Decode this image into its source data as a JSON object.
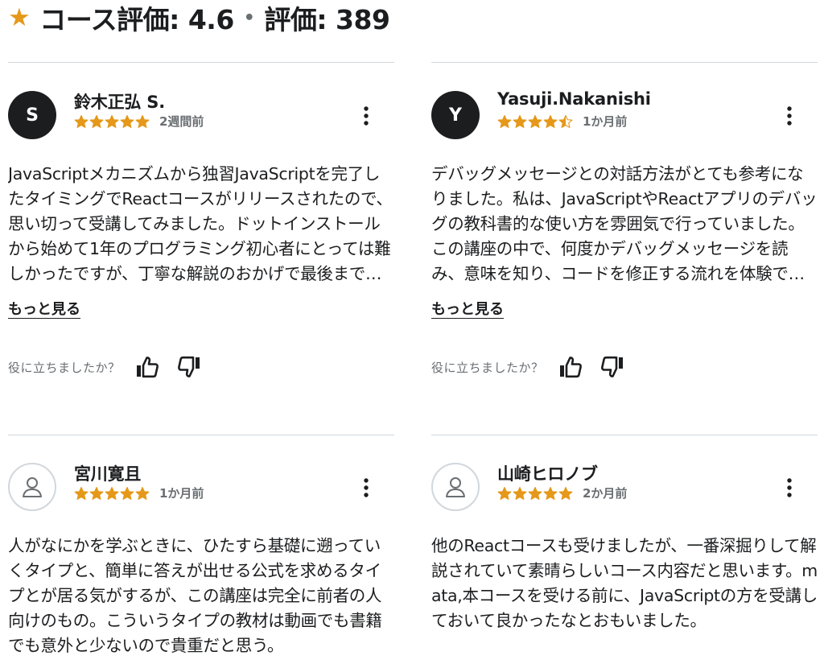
{
  "rating_header": {
    "star_icon": "star-icon",
    "rating_label": "コース評価: 4.6",
    "separator": "•",
    "count_label": "評価: 389"
  },
  "reviews": [
    {
      "avatar_initial": "S",
      "name": "鈴木正弘 S.",
      "rating": 5,
      "date": "2週間前",
      "body": "JavaScriptメカニズムから独習JavaScriptを完了したタイミングでReactコースがリリースされたので、思い切って受講してみました。ドットインストールから始めて1年のプログラミング初心者にとっては難しかったですが、丁寧な解説のおかげで最後まで進めることができました。",
      "show_more": "もっと見る",
      "helpful_label": "役に立ちましたか？"
    },
    {
      "avatar_initial": "Y",
      "name": "Yasuji.Nakanishi",
      "rating": 4.5,
      "date": "1か月前",
      "body": "デバッグメッセージとの対話方法がとても参考になりました。私は、JavaScriptやReactアプリのデバッグの教科書的な使い方を雰囲気で行っていました。この講座の中で、何度かデバッグメッセージを読み、意味を知り、コードを修正する流れを体験できました。",
      "show_more": "もっと見る",
      "helpful_label": "役に立ちましたか？"
    },
    {
      "avatar_initial": "",
      "name": "宮川寛且",
      "rating": 5,
      "date": "1か月前",
      "body": "人がなにかを学ぶときに、ひたすら基礎に遡っていくタイプと、簡単に答えが出せる公式を求めるタイプとが居る気がするが、この講座は完全に前者の人向けのもの。こういうタイプの教材は動画でも書籍でも意外と少ないので貴重だと思う。",
      "show_more": "",
      "helpful_label": ""
    },
    {
      "avatar_initial": "",
      "name": "山崎ヒロノブ",
      "rating": 5,
      "date": "2か月前",
      "body": "他のReactコースも受けましたが、一番深掘りして解説されていて素晴らしいコース内容だと思います。mata,本コースを受ける前に、JavaScriptの方を受講しておいて良かったなとおもいました。",
      "show_more": "",
      "helpful_label": ""
    }
  ],
  "colors": {
    "star": "#e59819",
    "text": "#1c1d1f",
    "muted": "#6a6f73",
    "divider": "#d1d7dc"
  }
}
